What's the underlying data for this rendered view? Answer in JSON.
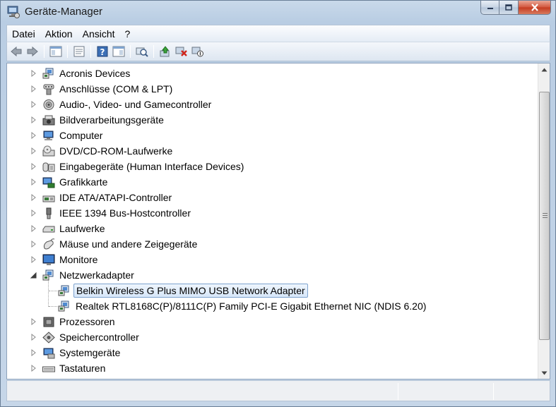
{
  "window": {
    "title": "Geräte-Manager",
    "icon": "device-manager-icon"
  },
  "menu": [
    {
      "label": "Datei"
    },
    {
      "label": "Aktion"
    },
    {
      "label": "Ansicht"
    },
    {
      "label": "?"
    }
  ],
  "toolbar": {
    "buttons": [
      "back-icon",
      "forward-icon",
      "show-hide-console-tree-icon",
      "properties-icon",
      "help-icon",
      "show-action-pane-icon",
      "scan-hardware-changes-icon",
      "update-driver-icon",
      "uninstall-icon",
      "disable-device-icon"
    ]
  },
  "tree": {
    "categories": [
      {
        "label": "Acronis Devices",
        "icon": "network-icon"
      },
      {
        "label": "Anschlüsse (COM & LPT)",
        "icon": "port-icon"
      },
      {
        "label": "Audio-, Video- und Gamecontroller",
        "icon": "speaker-icon"
      },
      {
        "label": "Bildverarbeitungsgeräte",
        "icon": "camera-icon"
      },
      {
        "label": "Computer",
        "icon": "computer-icon"
      },
      {
        "label": "DVD/CD-ROM-Laufwerke",
        "icon": "optical-drive-icon"
      },
      {
        "label": "Eingabegeräte (Human Interface Devices)",
        "icon": "hid-icon"
      },
      {
        "label": "Grafikkarte",
        "icon": "display-adapter-icon"
      },
      {
        "label": "IDE ATA/ATAPI-Controller",
        "icon": "ide-controller-icon"
      },
      {
        "label": "IEEE 1394 Bus-Hostcontroller",
        "icon": "firewire-icon"
      },
      {
        "label": "Laufwerke",
        "icon": "disk-drive-icon"
      },
      {
        "label": "Mäuse und andere Zeigegeräte",
        "icon": "mouse-icon"
      },
      {
        "label": "Monitore",
        "icon": "monitor-icon"
      },
      {
        "label": "Netzwerkadapter",
        "icon": "network-adapter-icon",
        "expanded": true
      },
      {
        "label": "Prozessoren",
        "icon": "processor-icon"
      },
      {
        "label": "Speichercontroller",
        "icon": "storage-controller-icon"
      },
      {
        "label": "Systemgeräte",
        "icon": "system-devices-icon"
      },
      {
        "label": "Tastaturen",
        "icon": "keyboard-icon"
      }
    ],
    "network_children": [
      {
        "label": "Belkin Wireless G Plus MIMO USB Network Adapter",
        "selected": true
      },
      {
        "label": "Realtek RTL8168C(P)/8111C(P) Family PCI-E Gigabit Ethernet NIC (NDIS 6.20)",
        "selected": false
      }
    ]
  },
  "statusbar": {
    "text": ""
  }
}
